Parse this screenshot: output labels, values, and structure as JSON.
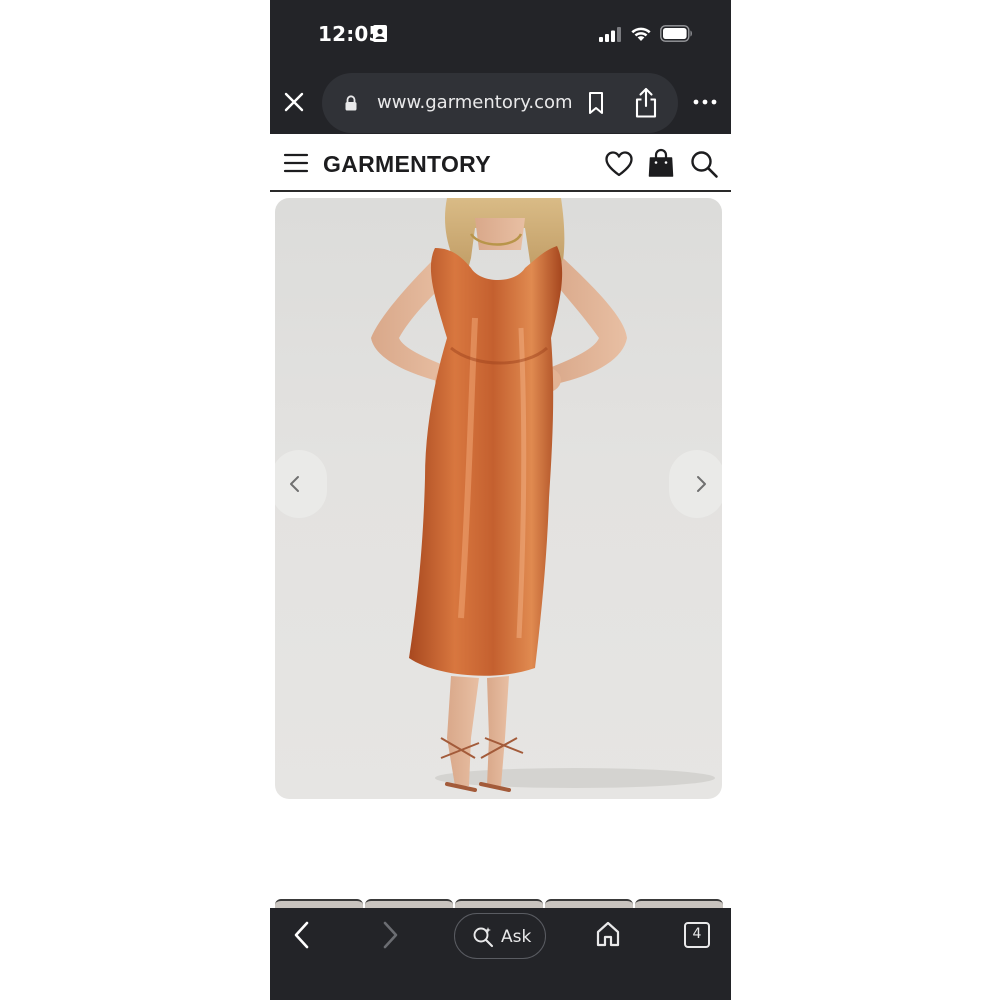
{
  "status_bar": {
    "time": "12:05",
    "icons": [
      "id-card-icon",
      "cellular-signal-icon",
      "wifi-icon",
      "battery-icon"
    ]
  },
  "browser": {
    "url": "www.garmentory.com",
    "icons": [
      "close-icon",
      "lock-icon",
      "bookmark-icon",
      "share-icon",
      "more-icon"
    ]
  },
  "site_header": {
    "brand": "GARMENTORY",
    "icons": [
      "hamburger-menu-icon",
      "heart-icon",
      "shopping-bag-icon",
      "search-icon"
    ]
  },
  "product_image": {
    "description_color": "#c4602f",
    "carousel_icons": [
      "chevron-left-icon",
      "chevron-right-icon"
    ]
  },
  "bottom_bar": {
    "ask_label": "Ask",
    "tab_count": "4",
    "icons": [
      "back-icon",
      "forward-icon",
      "ask-sparkle-search-icon",
      "home-icon",
      "tabs-icon"
    ]
  },
  "colors": {
    "chrome_bg": "#232428",
    "url_pill_bg": "#303237",
    "dress": "#c4602f"
  }
}
